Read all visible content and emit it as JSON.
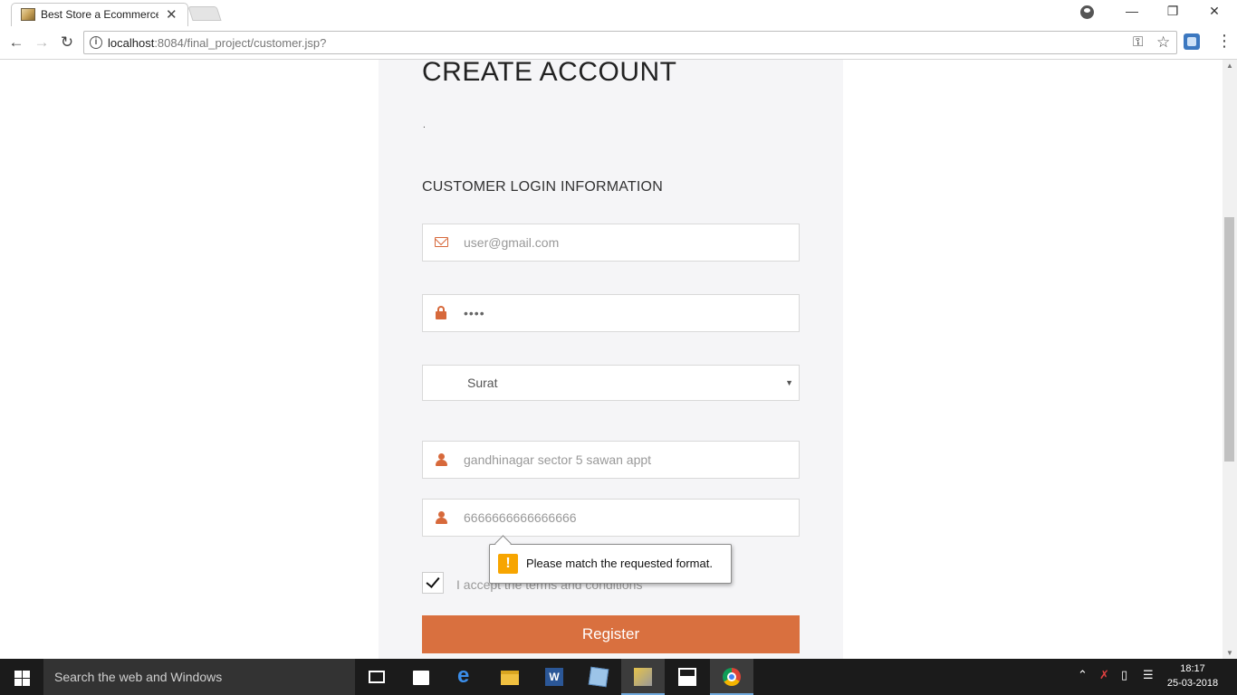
{
  "browser": {
    "tab_title": "Best Store a Ecommerce",
    "tab_close": "✕",
    "url_host": "localhost",
    "url_path": ":8084/final_project/customer.jsp?"
  },
  "page": {
    "title": "CREATE ACCOUNT",
    "dot": ".",
    "section_title": "CUSTOMER LOGIN INFORMATION",
    "email_value": "user@gmail.com",
    "password_value": "••••",
    "city_selected": "Surat",
    "address_value": "gandhinagar sector 5 sawan appt",
    "phone_value": "6666666666666666",
    "terms_label": "I accept the terms and conditions",
    "terms_checked": true,
    "register_label": "Register"
  },
  "validation_tooltip": {
    "text": "Please match the requested format."
  },
  "taskbar": {
    "search_placeholder": "Search the web and Windows",
    "time": "18:17",
    "date": "25-03-2018"
  },
  "colors": {
    "accent": "#d9703f",
    "warning": "#f7a500",
    "taskbar": "#1b1b1b"
  }
}
